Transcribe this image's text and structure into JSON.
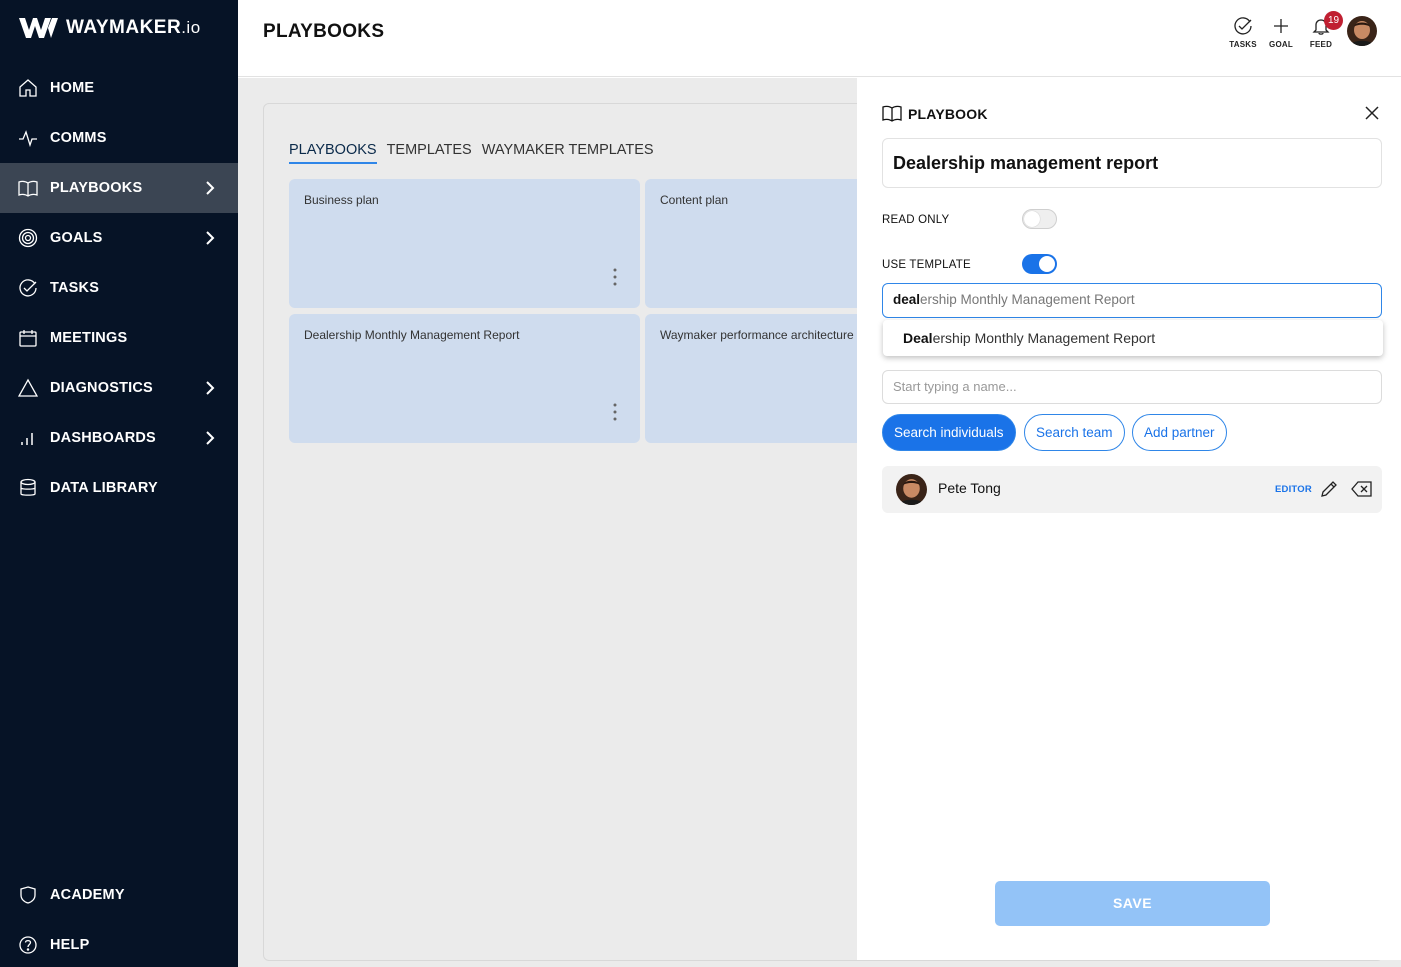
{
  "brand": {
    "name": "WAYMAKER",
    "suffix": ".io"
  },
  "sidebar": {
    "items": [
      {
        "label": "HOME",
        "icon": "home-icon"
      },
      {
        "label": "COMMS",
        "icon": "pulse-icon"
      },
      {
        "label": "PLAYBOOKS",
        "icon": "book-icon",
        "active": true
      },
      {
        "label": "GOALS",
        "icon": "target-icon"
      },
      {
        "label": "TASKS",
        "icon": "check-circle-icon"
      },
      {
        "label": "MEETINGS",
        "icon": "calendar-icon"
      },
      {
        "label": "DIAGNOSTICS",
        "icon": "triangle-icon"
      },
      {
        "label": "DASHBOARDS",
        "icon": "bar-chart-icon"
      },
      {
        "label": "DATA LIBRARY",
        "icon": "database-icon"
      }
    ],
    "bottom": [
      {
        "label": "ACADEMY",
        "icon": "shield-icon"
      },
      {
        "label": "HELP",
        "icon": "help-icon"
      }
    ]
  },
  "header": {
    "title": "PLAYBOOKS",
    "tasks_label": "TASKS",
    "goal_label": "GOAL",
    "feed_label": "FEED",
    "feed_count": "19"
  },
  "main": {
    "tabs": [
      {
        "label": "PLAYBOOKS",
        "active": true
      },
      {
        "label": "TEMPLATES"
      },
      {
        "label": "WAYMAKER TEMPLATES"
      }
    ],
    "cards": [
      {
        "name": "Business plan"
      },
      {
        "name": "Content plan"
      },
      {
        "name": "Dealership Monthly Management Report"
      },
      {
        "name": "Waymaker performance architecture"
      }
    ]
  },
  "panel": {
    "title": "PLAYBOOK",
    "name_value": "Dealership management report",
    "read_only_label": "READ ONLY",
    "read_only": false,
    "use_template_label": "USE TEMPLATE",
    "use_template": true,
    "template_typed": "deal",
    "template_suggestion_rest": "ership Monthly Management Report",
    "dropdown_match": "Deal",
    "dropdown_rest": "ership Monthly Management Report",
    "people_placeholder": "Start typing a name...",
    "buttons": {
      "search_individuals": "Search individuals",
      "search_team": "Search team",
      "add_partner": "Add partner"
    },
    "member": {
      "name": "Pete Tong",
      "role": "EDITOR"
    },
    "save_label": "SAVE"
  },
  "colors": {
    "sidebar_bg": "#061326",
    "accent": "#1a73e8",
    "card_bg": "#cfdcee",
    "badge": "#c01f31"
  }
}
